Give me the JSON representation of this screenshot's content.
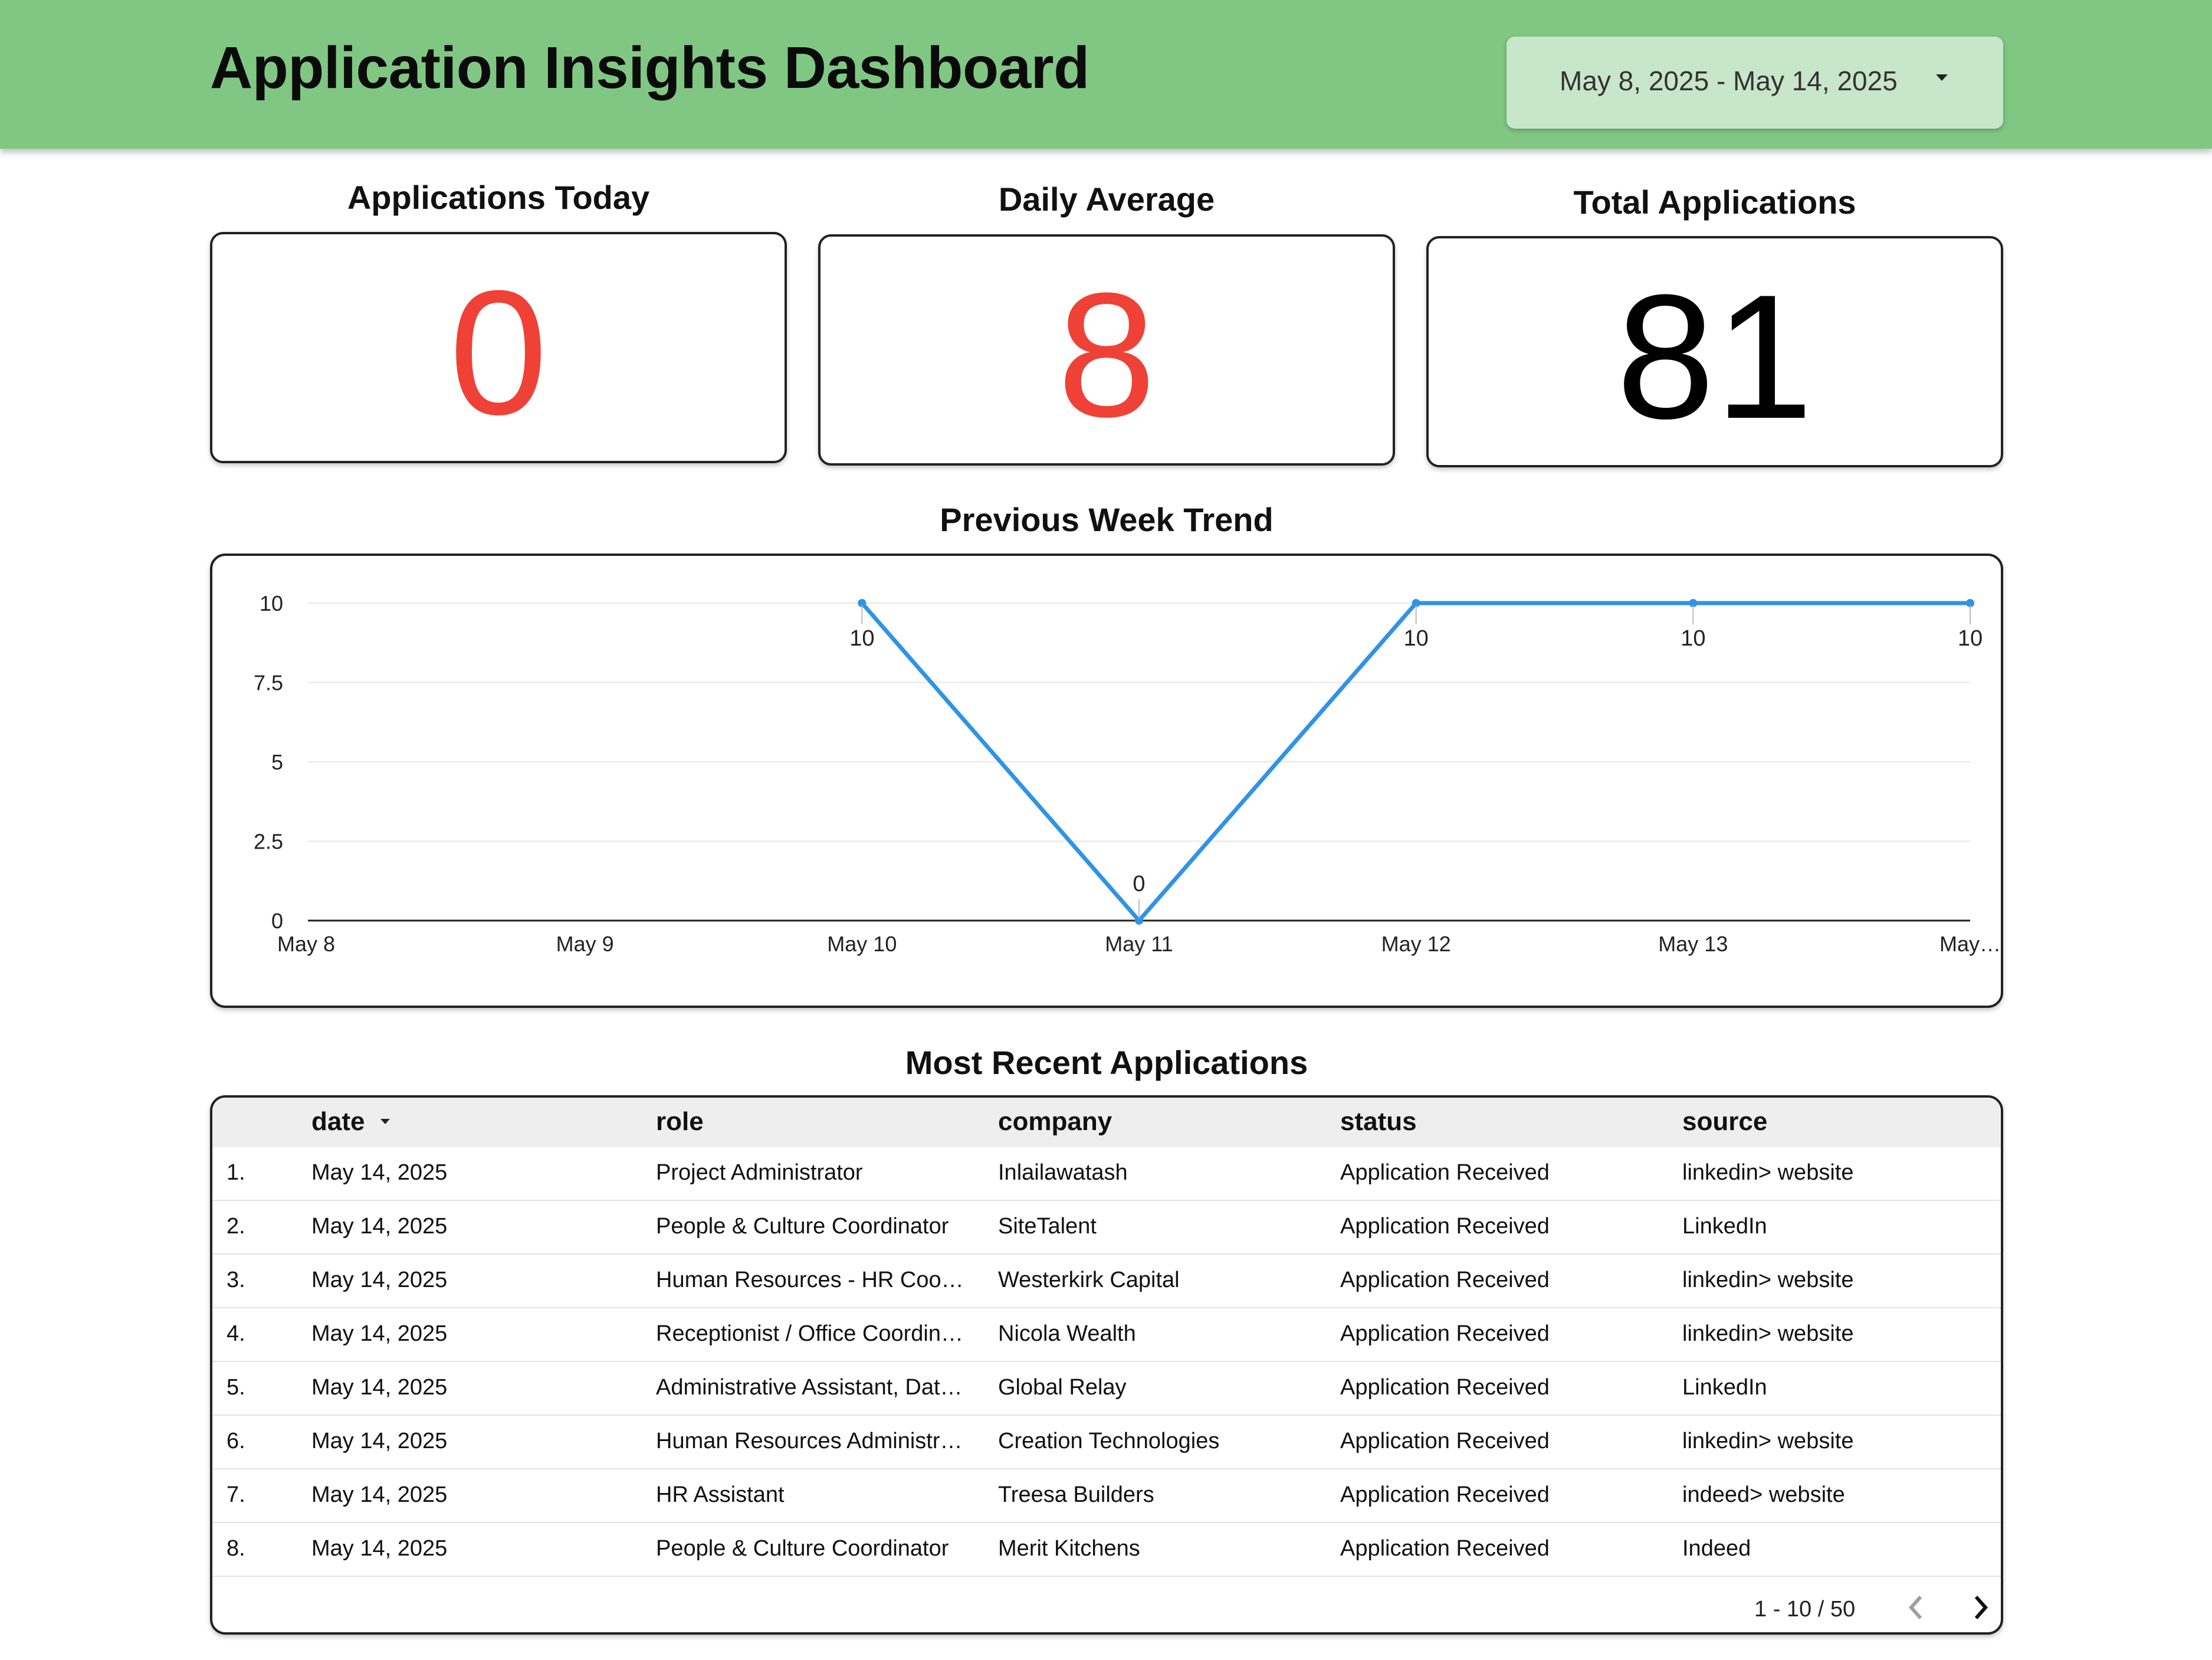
{
  "header": {
    "title": "Application Insights Dashboard",
    "date_range": "May 8, 2025 - May 14, 2025",
    "background": "#81c784",
    "picker_background": "#c8e6c9"
  },
  "kpis": [
    {
      "title": "Applications Today",
      "value": "0",
      "color": "#ef4136"
    },
    {
      "title": "Daily Average",
      "value": "8",
      "color": "#ef4136"
    },
    {
      "title": "Total Applications",
      "value": "81",
      "color": "#000000"
    }
  ],
  "trend": {
    "title": "Previous Week Trend"
  },
  "chart_data": {
    "type": "line",
    "categories": [
      "May 8",
      "May 9",
      "May 10",
      "May 11",
      "May 12",
      "May 13",
      "May…"
    ],
    "series": [
      {
        "values": [
          null,
          null,
          10,
          0,
          10,
          10,
          10
        ],
        "color": "#2f93e6"
      }
    ],
    "ylim": [
      0,
      10
    ],
    "yticks": [
      "0",
      "2.5",
      "5",
      "7.5",
      "10"
    ],
    "grid": true,
    "data_labels": true
  },
  "recent": {
    "title": "Most Recent Applications",
    "columns": [
      "date",
      "role",
      "company",
      "status",
      "source"
    ],
    "rows": [
      {
        "num": "1.",
        "date": "May 14, 2025",
        "role": "Project Administrator",
        "company": "Inlailawatash",
        "status": "Application Received",
        "source": "linkedin> website"
      },
      {
        "num": "2.",
        "date": "May 14, 2025",
        "role": "People & Culture Coordinator",
        "company": "SiteTalent",
        "status": "Application Received",
        "source": "LinkedIn"
      },
      {
        "num": "3.",
        "date": "May 14, 2025",
        "role": "Human Resources - HR Coord…",
        "company": "Westerkirk Capital",
        "status": "Application Received",
        "source": "linkedin> website"
      },
      {
        "num": "4.",
        "date": "May 14, 2025",
        "role": "Receptionist / Office Coordina…",
        "company": "Nicola Wealth",
        "status": "Application Received",
        "source": "linkedin> website"
      },
      {
        "num": "5.",
        "date": "May 14, 2025",
        "role": "Administrative Assistant, Dat…",
        "company": "Global Relay",
        "status": "Application Received",
        "source": "LinkedIn"
      },
      {
        "num": "6.",
        "date": "May 14, 2025",
        "role": "Human Resources Administr…",
        "company": "Creation Technologies",
        "status": "Application Received",
        "source": "linkedin> website"
      },
      {
        "num": "7.",
        "date": "May 14, 2025",
        "role": "HR Assistant",
        "company": "Treesa Builders",
        "status": "Application Received",
        "source": "indeed> website"
      },
      {
        "num": "8.",
        "date": "May 14, 2025",
        "role": "People & Culture Coordinator",
        "company": "Merit Kitchens",
        "status": "Application Received",
        "source": "Indeed"
      }
    ],
    "pagination": "1 - 10 / 50"
  }
}
